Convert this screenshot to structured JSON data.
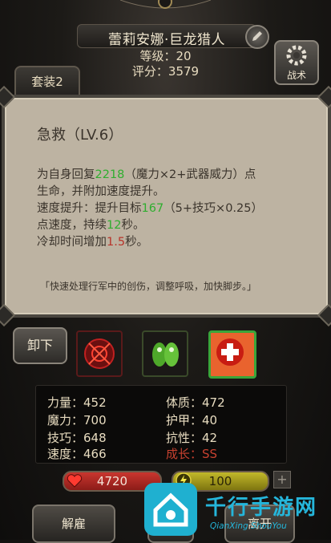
{
  "header": {
    "hero_name": "蕾莉安娜·巨龙猎人",
    "level": "等级：20",
    "score": "评分：3579",
    "suit_tab": "套装2",
    "tactics_label": "战术"
  },
  "popup": {
    "title": "急救（LV.6）",
    "line1_a": "为自身回复",
    "line1_heal": "2218",
    "line1_b": "（魔力×2+武器威力）点",
    "line2": "生命，并附加速度提升。",
    "line3_a": "速度提升：提升目标",
    "line3_val": "167",
    "line3_b": "（5+技巧×0.25）",
    "line4_a": "点速度，持续",
    "line4_val": "12",
    "line4_b": "秒。",
    "line5_a": "冷却时间增加",
    "line5_val": "1.5",
    "line5_b": "秒。",
    "quote": "「快速处理行军中的创伤，调整呼吸，加快脚步。」"
  },
  "actions": {
    "unload": "卸下"
  },
  "stats": {
    "strength": "力量：452",
    "magic": "魔力：700",
    "skill": "技巧：648",
    "speed": "速度：466",
    "constitution": "体质：472",
    "armor": "护甲：40",
    "resistance": "抗性：42",
    "growth": "成长：SS"
  },
  "bars": {
    "hp": "4720",
    "mp": "100",
    "plus": "+"
  },
  "bottom": {
    "dismiss": "解雇",
    "right": "离开"
  },
  "watermark": {
    "title": "千行手游网",
    "sub": "QianXing ShouYou"
  },
  "colors": {
    "heal_green": "#2fae2f",
    "cooldown_red": "#b8332a",
    "growth_red": "#c7412f"
  }
}
